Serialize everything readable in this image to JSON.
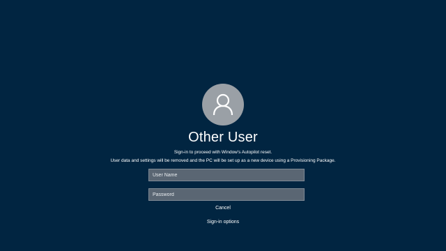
{
  "user": {
    "display_name": "Other User"
  },
  "messages": {
    "line1": "Sign-in to proceed with Window's Autopilot reset.",
    "line2": "User data and settings will be removed and the PC will be set up as a new device using a Provisioning Package."
  },
  "form": {
    "username_placeholder": "User Name",
    "password_placeholder": "Password"
  },
  "actions": {
    "cancel_label": "Cancel",
    "signin_options_label": "Sign-in options"
  },
  "colors": {
    "background": "#012541",
    "avatar": "#9aa0a6",
    "field_background": "#5a6673"
  },
  "icons": {
    "avatar": "user-icon"
  }
}
